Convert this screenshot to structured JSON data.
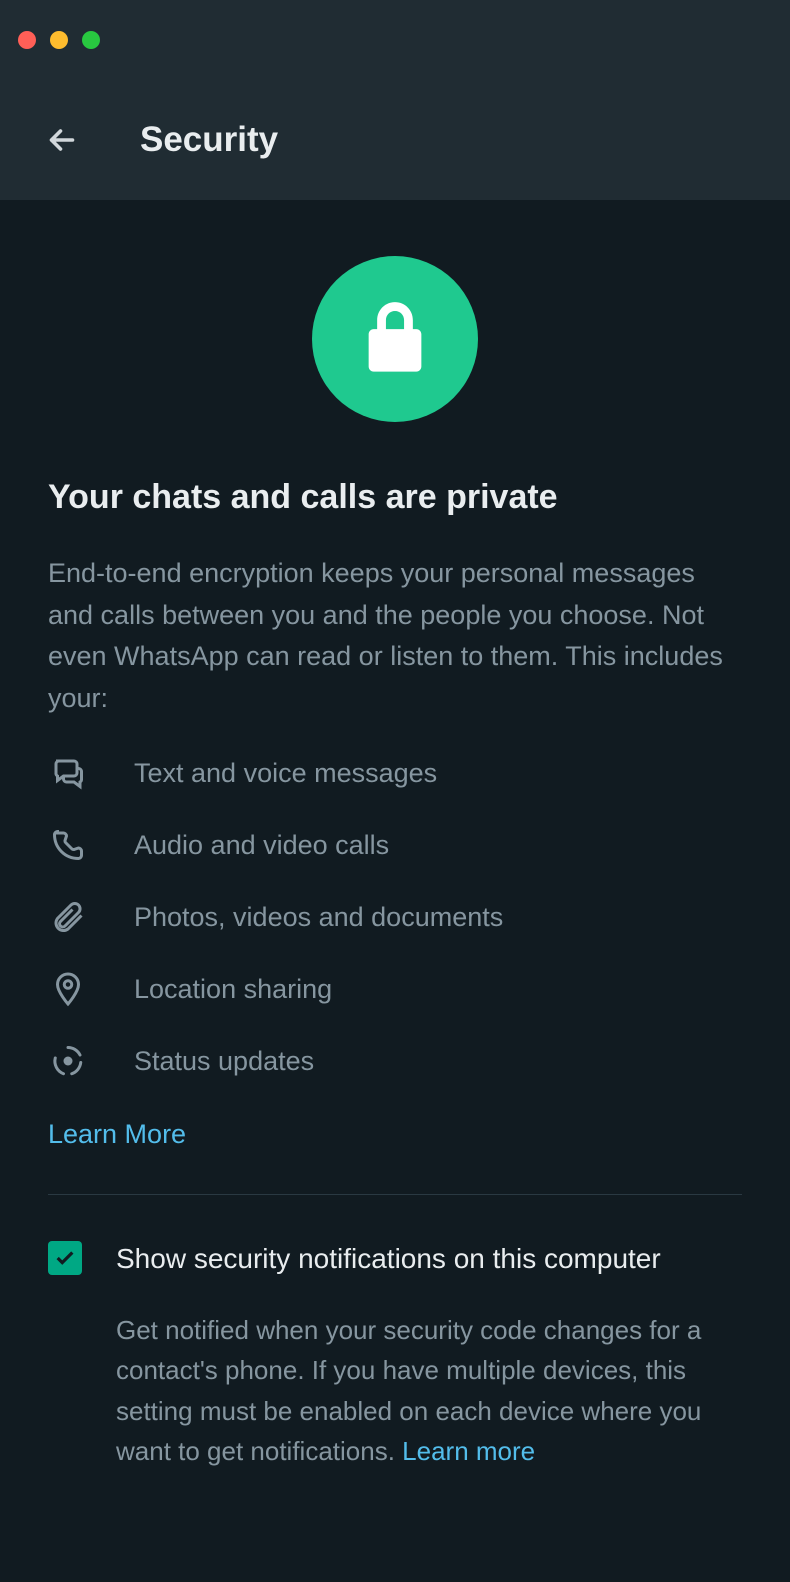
{
  "header": {
    "title": "Security"
  },
  "hero": {
    "heading": "Your chats and calls are private",
    "description": "End-to-end encryption keeps your personal messages and calls between you and the people you choose. Not even WhatsApp can read or listen to them. This includes your:"
  },
  "features": [
    {
      "icon": "chat-icon",
      "label": "Text and voice messages"
    },
    {
      "icon": "phone-icon",
      "label": "Audio and video calls"
    },
    {
      "icon": "attachment-icon",
      "label": "Photos, videos and documents"
    },
    {
      "icon": "location-icon",
      "label": "Location sharing"
    },
    {
      "icon": "status-icon",
      "label": "Status updates"
    }
  ],
  "learn_more_top": "Learn More",
  "setting": {
    "checked": true,
    "title": "Show security notifications on this computer",
    "description": "Get notified when your security code changes for a contact's phone. If you have multiple devices, this setting must be enabled on each device where you want to get notifications. ",
    "learn_more": "Learn more"
  },
  "colors": {
    "accent_green": "#00a884",
    "hero_green": "#1fc98f",
    "link_blue": "#53bdeb",
    "bg_dark": "#111b21",
    "bg_header": "#202c33",
    "text_primary": "#e9edef",
    "text_secondary": "#8696a0"
  }
}
